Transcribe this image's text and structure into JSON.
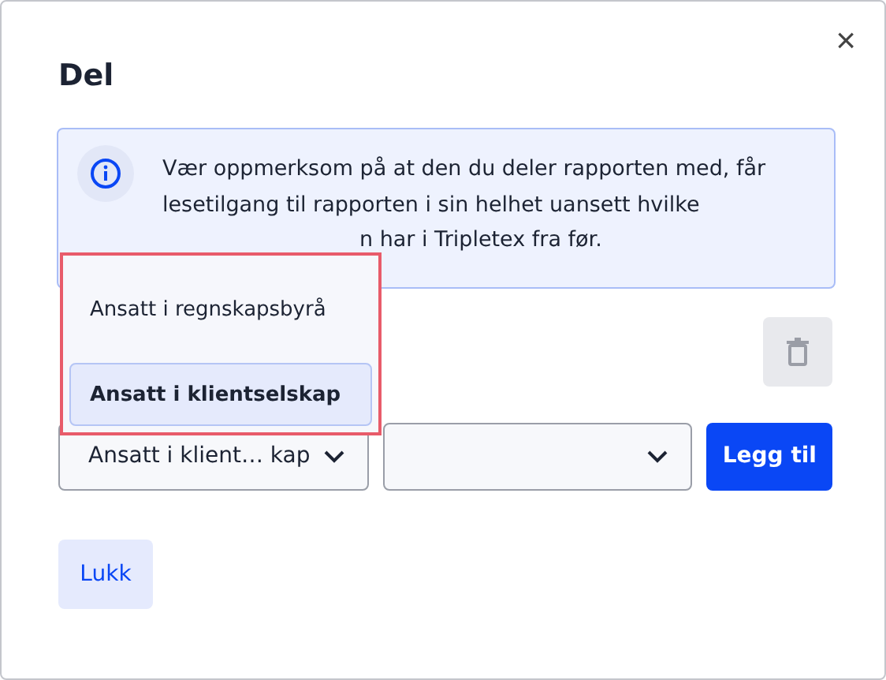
{
  "dialog": {
    "title": "Del",
    "close": "×"
  },
  "notice": {
    "text": "Vær oppmerksom på at den du deler rapporten med, får lesetilgang til rapporten i sin helhet uansett hvilke",
    "visible_tail": "n har i Tripletex fra før."
  },
  "dropdown": {
    "options": [
      {
        "label": "Ansatt i regnskapsbyrå",
        "selected": false
      },
      {
        "label": "Ansatt i klientselskap",
        "selected": true
      }
    ]
  },
  "row": {
    "type_select": "Ansatt i klient… kap",
    "add_button": "Legg til"
  },
  "close_button": "Lukk"
}
